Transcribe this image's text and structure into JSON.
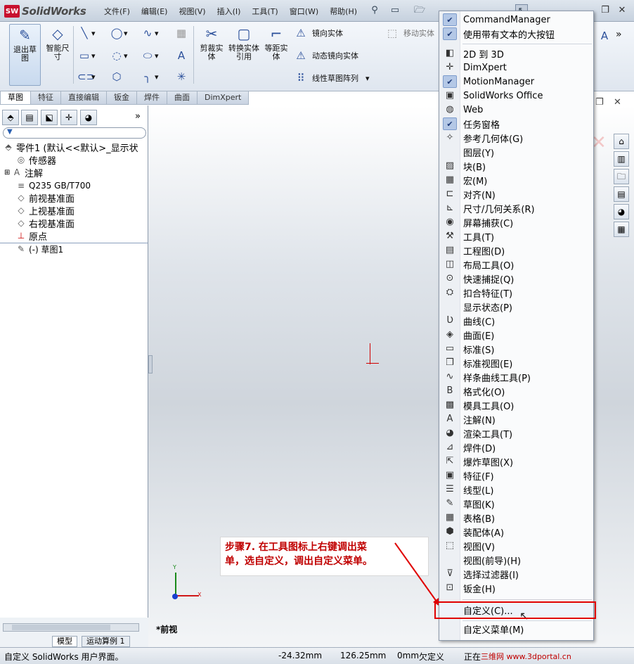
{
  "app": {
    "logo_text": "SolidWorks",
    "logo_badge": "SW"
  },
  "menubar": [
    "文件(F)",
    "编辑(E)",
    "视图(V)",
    "插入(I)",
    "工具(T)",
    "窗口(W)",
    "帮助(H)"
  ],
  "ribbon": {
    "exit_sketch": "退出草图",
    "smart_dimension": "智能尺寸",
    "trim": "剪裁实体",
    "convert": "转换实体引用",
    "offset": "等距实体",
    "mirror": "镜向实体",
    "dyn_mirror": "动态镜向实体",
    "linear_pattern": "线性草图阵列",
    "move": "移动实体"
  },
  "command_tabs": [
    "草图",
    "特征",
    "直接编辑",
    "钣金",
    "焊件",
    "曲面",
    "DimXpert"
  ],
  "feature_tree": [
    {
      "label": "零件1 (默认<<默认>_显示状",
      "icon": "part-icon"
    },
    {
      "label": "传感器",
      "icon": "sensor-icon"
    },
    {
      "label": "注解",
      "icon": "annotation-icon"
    },
    {
      "label": "Q235 GB/T700",
      "icon": "material-icon"
    },
    {
      "label": "前视基准面",
      "icon": "plane-icon"
    },
    {
      "label": "上视基准面",
      "icon": "plane-icon"
    },
    {
      "label": "右视基准面",
      "icon": "plane-icon"
    },
    {
      "label": "原点",
      "icon": "origin-icon"
    },
    {
      "label": "(-) 草图1",
      "icon": "sketch-icon"
    }
  ],
  "bottom_tabs": [
    "模型",
    "运动算例 1"
  ],
  "view_label": "*前视",
  "axis": {
    "y": "Y",
    "x": "X"
  },
  "context_menu": {
    "items_top": [
      {
        "label": "CommandManager",
        "checked": true
      },
      {
        "label": "使用带有文本的大按钮",
        "checked": true
      }
    ],
    "items": [
      {
        "label": "2D 到 3D",
        "icon": "2d-to-3d-icon"
      },
      {
        "label": "DimXpert",
        "icon": "dimxpert-icon"
      },
      {
        "label": "MotionManager",
        "icon": "check-icon",
        "checked": true
      },
      {
        "label": "SolidWorks Office",
        "icon": "office-icon"
      },
      {
        "label": "Web",
        "icon": "web-icon"
      },
      {
        "label": "任务窗格",
        "icon": "check-icon",
        "checked": true
      },
      {
        "label": "参考几何体(G)",
        "icon": "ref-geometry-icon"
      },
      {
        "label": "图层(Y)",
        "icon": "none"
      },
      {
        "label": "块(B)",
        "icon": "block-icon"
      },
      {
        "label": "宏(M)",
        "icon": "macro-icon"
      },
      {
        "label": "对齐(N)",
        "icon": "align-icon"
      },
      {
        "label": "尺寸/几何关系(R)",
        "icon": "dimension-icon"
      },
      {
        "label": "屏幕捕获(C)",
        "icon": "capture-icon"
      },
      {
        "label": "工具(T)",
        "icon": "tools-icon"
      },
      {
        "label": "工程图(D)",
        "icon": "drawing-icon"
      },
      {
        "label": "布局工具(O)",
        "icon": "layout-icon"
      },
      {
        "label": "快速捕捉(Q)",
        "icon": "snap-icon"
      },
      {
        "label": "扣合特征(T)",
        "icon": "fastening-icon"
      },
      {
        "label": "显示状态(P)",
        "icon": "none"
      },
      {
        "label": "曲线(C)",
        "icon": "curve-icon"
      },
      {
        "label": "曲面(E)",
        "icon": "surface-icon"
      },
      {
        "label": "标准(S)",
        "icon": "standard-icon"
      },
      {
        "label": "标准视图(E)",
        "icon": "standard-views-icon"
      },
      {
        "label": "样条曲线工具(P)",
        "icon": "spline-icon"
      },
      {
        "label": "格式化(O)",
        "icon": "format-icon"
      },
      {
        "label": "模具工具(O)",
        "icon": "mold-icon"
      },
      {
        "label": "注解(N)",
        "icon": "annotation-icon"
      },
      {
        "label": "渲染工具(T)",
        "icon": "render-icon"
      },
      {
        "label": "焊件(D)",
        "icon": "weldment-icon"
      },
      {
        "label": "爆炸草图(X)",
        "icon": "explode-icon"
      },
      {
        "label": "特征(F)",
        "icon": "features-icon"
      },
      {
        "label": "线型(L)",
        "icon": "linetype-icon"
      },
      {
        "label": "草图(K)",
        "icon": "sketch-icon"
      },
      {
        "label": "表格(B)",
        "icon": "table-icon"
      },
      {
        "label": "装配体(A)",
        "icon": "assembly-icon"
      },
      {
        "label": "视图(V)",
        "icon": "view-icon"
      },
      {
        "label": "视图(前导)(H)",
        "icon": "none"
      },
      {
        "label": "选择过滤器(I)",
        "icon": "filter-icon"
      },
      {
        "label": "钣金(H)",
        "icon": "sheetmetal-icon"
      }
    ],
    "customize": "自定义(C)...",
    "customize_menu": "自定义菜单(M)"
  },
  "annotation": {
    "line1": "步骤7. 在工具图标上右键调出菜",
    "line2": "单，选自定义，调出自定义菜单。"
  },
  "statusbar": {
    "left": "自定义 SolidWorks 用户界面。",
    "x": "-24.32mm",
    "y": "126.25mm",
    "z": "0mm",
    "state": "欠定义",
    "editing": "正在",
    "watermark": "三维网 www.3dportal.cn"
  }
}
